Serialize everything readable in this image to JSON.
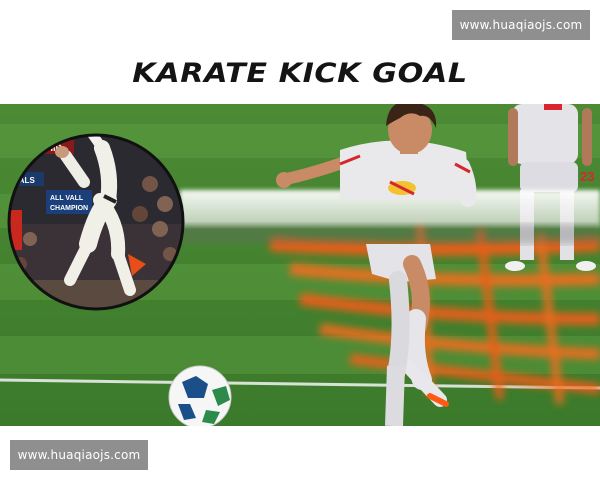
{
  "watermark": {
    "top_text": "www.huaqiaojs.com",
    "bottom_text": "www.huaqiaojs.com"
  },
  "headline": {
    "text": "KARATE KICK GOAL"
  },
  "photo": {
    "inset_banner_text": "NSHIP",
    "inset_sign_text_1": "ALL VALL",
    "inset_sign_text_2": "CHAMPION",
    "inset_side_text": "NALS",
    "jersey_number": "23",
    "colors": {
      "grass_dark": "#3f7f2f",
      "grass_light": "#5a9a3e",
      "kick_trail": "#ff5a14",
      "jersey": "#e9e9ec",
      "skin": "#c98a66",
      "hair": "#3a2418"
    }
  }
}
